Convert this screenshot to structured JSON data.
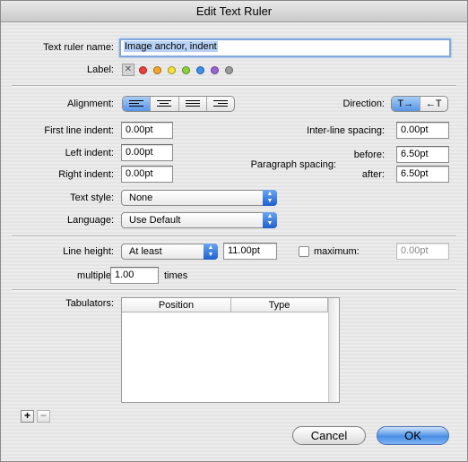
{
  "window": {
    "title": "Edit Text Ruler"
  },
  "name": {
    "label": "Text ruler name:",
    "value": "Image anchor, indent"
  },
  "label": {
    "label": "Label:",
    "colors": [
      "#ee3b3b",
      "#f5a623",
      "#f3e23a",
      "#8cd13d",
      "#3a8ef0",
      "#9b62d8",
      "#9a9a9a"
    ]
  },
  "alignment": {
    "label": "Alignment:",
    "options": [
      "left",
      "center",
      "justify",
      "right"
    ],
    "selected": "left"
  },
  "direction": {
    "label": "Direction:",
    "options": [
      "T→",
      "←T"
    ],
    "selected": "T→"
  },
  "indents": {
    "first_line": {
      "label": "First line indent:",
      "value": "0.00pt"
    },
    "left": {
      "label": "Left indent:",
      "value": "0.00pt"
    },
    "right": {
      "label": "Right indent:",
      "value": "0.00pt"
    }
  },
  "spacing": {
    "interline": {
      "label": "Inter-line spacing:",
      "value": "0.00pt"
    },
    "paragraph_label": "Paragraph spacing:",
    "before": {
      "label": "before:",
      "value": "6.50pt"
    },
    "after": {
      "label": "after:",
      "value": "6.50pt"
    }
  },
  "text_style": {
    "label": "Text style:",
    "value": "None"
  },
  "language": {
    "label": "Language:",
    "value": "Use Default"
  },
  "line_height": {
    "label": "Line height:",
    "mode": "At least",
    "value": "11.00pt",
    "maximum_label": "maximum:",
    "maximum_value": "0.00pt",
    "maximum_checked": false,
    "multiple_label": "multiple:",
    "multiple_value": "1.00",
    "times_label": "times"
  },
  "tabulators": {
    "label": "Tabulators:",
    "columns": [
      "Position",
      "Type"
    ],
    "rows": []
  },
  "tab_controls": {
    "add": "+",
    "remove": "−"
  },
  "buttons": {
    "cancel": "Cancel",
    "ok": "OK"
  }
}
